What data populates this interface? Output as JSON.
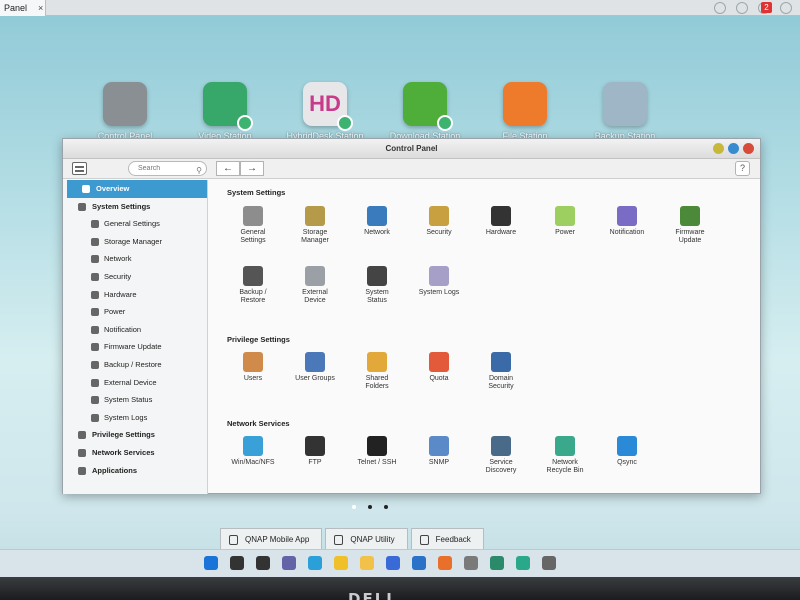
{
  "browser_tab": {
    "title": "Panel",
    "close": "×"
  },
  "browser_badge": "2",
  "desktop": {
    "apps": [
      {
        "label": "Control Panel",
        "icon": "gear-icon",
        "color": "#8a8f94"
      },
      {
        "label": "Video Station",
        "icon": "film-icon",
        "color": "#38a86a"
      },
      {
        "label": "HybridDesk Station",
        "icon": "hd-station-icon",
        "color": "#e7e7ea",
        "text": "HD"
      },
      {
        "label": "Download Station",
        "icon": "download-icon",
        "color": "#4fae3a"
      },
      {
        "label": "File Station",
        "icon": "folder-icon",
        "color": "#ee7a2c"
      },
      {
        "label": "Backup Station",
        "icon": "backup-icon",
        "color": "#9fb6c6"
      }
    ]
  },
  "window": {
    "title": "Control Panel",
    "search_placeholder": "Search",
    "back": "←",
    "forward": "→",
    "help": "?"
  },
  "sidebar": {
    "items": [
      {
        "label": "Overview",
        "level": "top",
        "active": true,
        "icon": "overview-icon"
      },
      {
        "label": "System Settings",
        "level": "top",
        "icon": "gear-icon"
      },
      {
        "label": "General Settings",
        "level": "sub",
        "icon": "general-settings-icon"
      },
      {
        "label": "Storage Manager",
        "level": "sub",
        "icon": "storage-icon"
      },
      {
        "label": "Network",
        "level": "sub",
        "icon": "network-icon"
      },
      {
        "label": "Security",
        "level": "sub",
        "icon": "lock-icon"
      },
      {
        "label": "Hardware",
        "level": "sub",
        "icon": "hardware-icon"
      },
      {
        "label": "Power",
        "level": "sub",
        "icon": "power-icon"
      },
      {
        "label": "Notification",
        "level": "sub",
        "icon": "notification-icon"
      },
      {
        "label": "Firmware Update",
        "level": "sub",
        "icon": "firmware-icon"
      },
      {
        "label": "Backup / Restore",
        "level": "sub",
        "icon": "backup-icon"
      },
      {
        "label": "External Device",
        "level": "sub",
        "icon": "external-device-icon"
      },
      {
        "label": "System Status",
        "level": "sub",
        "icon": "monitor-icon"
      },
      {
        "label": "System Logs",
        "level": "sub",
        "icon": "logs-icon"
      },
      {
        "label": "Privilege Settings",
        "level": "top",
        "icon": "user-icon"
      },
      {
        "label": "Network Services",
        "level": "top",
        "icon": "globe-icon"
      },
      {
        "label": "Applications",
        "level": "top",
        "icon": "applications-icon"
      }
    ]
  },
  "sections": [
    {
      "title": "System Settings",
      "items": [
        {
          "label": "General\nSettings",
          "icon": "general-settings-icon",
          "color": "#8d8d8d"
        },
        {
          "label": "Storage\nManager",
          "icon": "storage-icon",
          "color": "#b59a4a"
        },
        {
          "label": "Network",
          "icon": "network-icon",
          "color": "#3a7bbd"
        },
        {
          "label": "Security",
          "icon": "lock-icon",
          "color": "#c9a040"
        },
        {
          "label": "Hardware",
          "icon": "hardware-icon",
          "color": "#333333"
        },
        {
          "label": "Power",
          "icon": "power-icon",
          "color": "#9ccf5f"
        },
        {
          "label": "Notification",
          "icon": "notification-icon",
          "color": "#7a6cc4"
        },
        {
          "label": "Firmware\nUpdate",
          "icon": "firmware-icon",
          "color": "#4c8a3a"
        },
        {
          "label": "Backup /\nRestore",
          "icon": "backup-icon",
          "color": "#555555"
        },
        {
          "label": "External\nDevice",
          "icon": "external-device-icon",
          "color": "#9aa0a6"
        },
        {
          "label": "System\nStatus",
          "icon": "monitor-icon",
          "color": "#444444"
        },
        {
          "label": "System Logs",
          "icon": "logs-icon",
          "color": "#a6a0c8"
        }
      ]
    },
    {
      "title": "Privilege Settings",
      "items": [
        {
          "label": "Users",
          "icon": "user-icon",
          "color": "#d08a4a"
        },
        {
          "label": "User Groups",
          "icon": "user-groups-icon",
          "color": "#4a78b8"
        },
        {
          "label": "Shared\nFolders",
          "icon": "shared-folder-icon",
          "color": "#e2a83a"
        },
        {
          "label": "Quota",
          "icon": "quota-icon",
          "color": "#e25a3a"
        },
        {
          "label": "Domain\nSecurity",
          "icon": "domain-security-icon",
          "color": "#3a6aa8"
        }
      ]
    },
    {
      "title": "Network Services",
      "items": [
        {
          "label": "Win/Mac/NFS",
          "icon": "win-mac-nfs-icon",
          "color": "#3aa0d8"
        },
        {
          "label": "FTP",
          "icon": "ftp-icon",
          "color": "#333333"
        },
        {
          "label": "Telnet / SSH",
          "icon": "terminal-icon",
          "color": "#222222"
        },
        {
          "label": "SNMP",
          "icon": "snmp-icon",
          "color": "#5a8ac8"
        },
        {
          "label": "Service\nDiscovery",
          "icon": "service-discovery-icon",
          "color": "#4a6a8a"
        },
        {
          "label": "Network\nRecycle Bin",
          "icon": "recycle-bin-icon",
          "color": "#3aa88a"
        },
        {
          "label": "Qsync",
          "icon": "sync-icon",
          "color": "#2a8ad8"
        }
      ]
    }
  ],
  "bottom_tabs": [
    {
      "label": "QNAP Mobile App",
      "icon": "mobile-icon"
    },
    {
      "label": "QNAP Utility",
      "icon": "tools-icon"
    },
    {
      "label": "Feedback",
      "icon": "feedback-icon"
    }
  ],
  "taskbar": {
    "icons": [
      {
        "name": "windows-start-icon",
        "color": "#1a73d8"
      },
      {
        "name": "search-icon",
        "color": "#333333"
      },
      {
        "name": "task-view-icon",
        "color": "#333333"
      },
      {
        "name": "chat-icon",
        "color": "#6264a7"
      },
      {
        "name": "edge-icon",
        "color": "#2a9fd8"
      },
      {
        "name": "notes-icon",
        "color": "#f0c02a"
      },
      {
        "name": "file-explorer-icon",
        "color": "#f2c14a"
      },
      {
        "name": "store-icon",
        "color": "#3a6ad8"
      },
      {
        "name": "mail-icon",
        "color": "#2a72c8"
      },
      {
        "name": "firefox-icon",
        "color": "#e8702a"
      },
      {
        "name": "settings-app-icon",
        "color": "#7a7a7a"
      },
      {
        "name": "app-icon",
        "color": "#2a8a6a"
      },
      {
        "name": "browser-icon",
        "color": "#2aa88a"
      },
      {
        "name": "gear-icon",
        "color": "#666666"
      }
    ]
  },
  "monitor_brand": "DELL"
}
